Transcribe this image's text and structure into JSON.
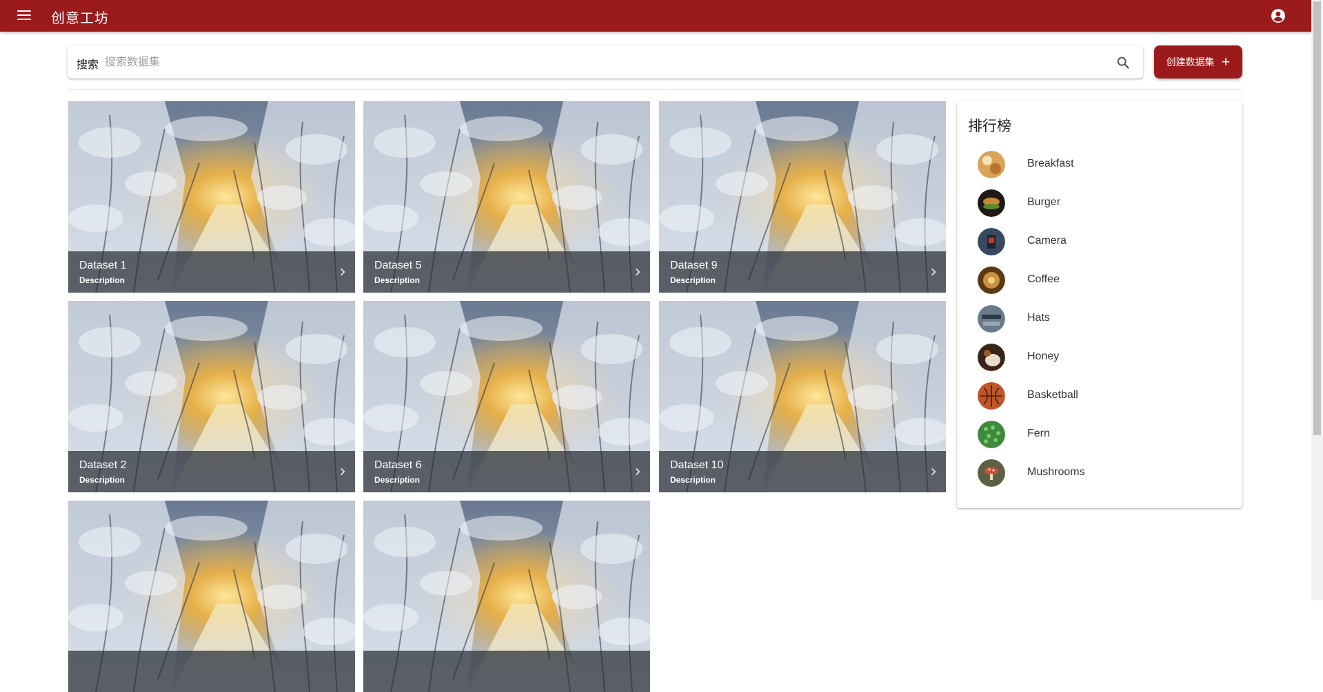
{
  "app": {
    "title": "创意工坊"
  },
  "search": {
    "label": "搜索",
    "placeholder": "搜索数据集",
    "value": ""
  },
  "create_button": {
    "label": "创建数据集"
  },
  "cards": [
    {
      "title": "Dataset 1",
      "description": "Description"
    },
    {
      "title": "Dataset 5",
      "description": "Description"
    },
    {
      "title": "Dataset 9",
      "description": "Description"
    },
    {
      "title": "Dataset 2",
      "description": "Description"
    },
    {
      "title": "Dataset 6",
      "description": "Description"
    },
    {
      "title": "Dataset 10",
      "description": "Description"
    },
    {
      "title": "",
      "description": ""
    },
    {
      "title": "",
      "description": ""
    }
  ],
  "leaderboard": {
    "title": "排行榜",
    "items": [
      {
        "label": "Breakfast",
        "color": "#d9a45a"
      },
      {
        "label": "Burger",
        "color": "#5b3a1a"
      },
      {
        "label": "Camera",
        "color": "#3a4a5e"
      },
      {
        "label": "Coffee",
        "color": "#8a5a1e"
      },
      {
        "label": "Hats",
        "color": "#6a7a8a"
      },
      {
        "label": "Honey",
        "color": "#7a4a2a"
      },
      {
        "label": "Basketball",
        "color": "#c0562a"
      },
      {
        "label": "Fern",
        "color": "#3e8a3a"
      },
      {
        "label": "Mushrooms",
        "color": "#6a6a4a"
      }
    ]
  },
  "theme": {
    "primary": "#9b1a1c"
  }
}
